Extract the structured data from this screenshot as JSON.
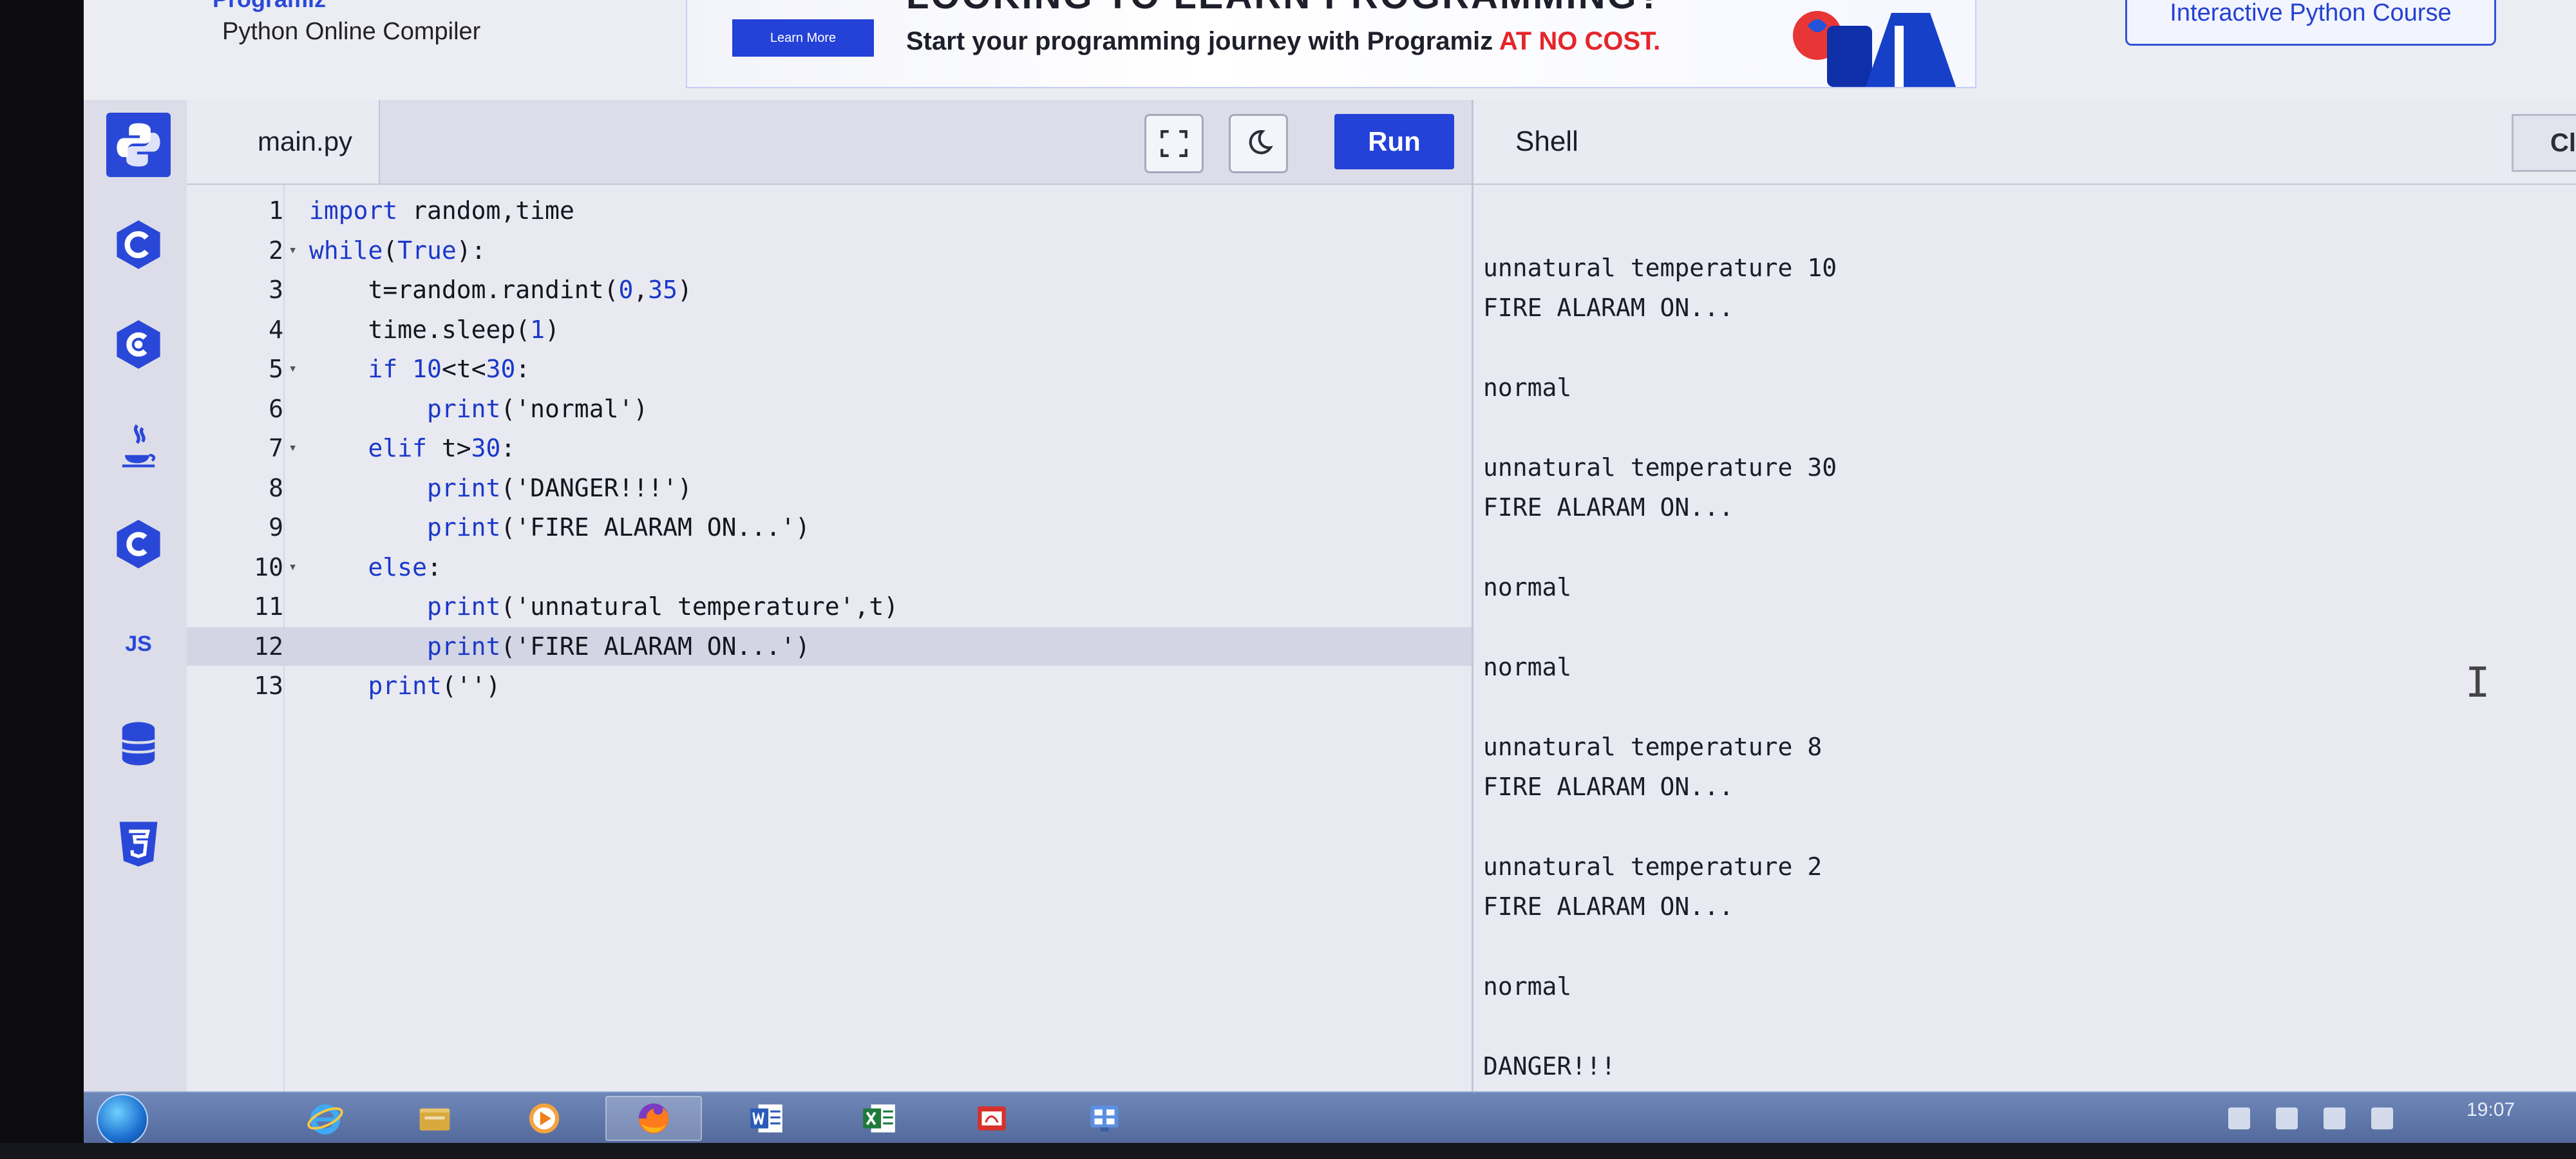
{
  "header": {
    "brand_top": "Programiz",
    "brand_subtitle": "Python Online Compiler",
    "ad": {
      "headline": "LOOKING TO LEARN PROGRAMMING?",
      "button_label": "Learn More",
      "text_main": "Start your programming journey with Programiz ",
      "text_emphasis": "AT NO COST."
    },
    "course_button": "Interactive Python Course"
  },
  "rail": {
    "items": [
      {
        "icon": "python-icon",
        "label": "Python",
        "active": true
      },
      {
        "icon": "c-icon",
        "label": "C"
      },
      {
        "icon": "cpp-icon",
        "label": "C++"
      },
      {
        "icon": "java-icon",
        "label": "Java"
      },
      {
        "icon": "csharp-icon",
        "label": "C#"
      },
      {
        "icon": "js-icon",
        "label": "JS"
      },
      {
        "icon": "database-icon",
        "label": "SQL"
      },
      {
        "icon": "html5-icon",
        "label": "HTML"
      }
    ],
    "js_text": "JS"
  },
  "editor": {
    "file_tab": "main.py",
    "run_label": "Run",
    "current_line": 12,
    "lines": [
      {
        "n": "1",
        "code": "import random,time"
      },
      {
        "n": "2",
        "code": "while(True):",
        "fold": true
      },
      {
        "n": "3",
        "code": "    t=random.randint(0,35)"
      },
      {
        "n": "4",
        "code": "    time.sleep(1)"
      },
      {
        "n": "5",
        "code": "    if 10<t<30:",
        "fold": true
      },
      {
        "n": "6",
        "code": "        print('normal')"
      },
      {
        "n": "7",
        "code": "    elif t>30:",
        "fold": true
      },
      {
        "n": "8",
        "code": "        print('DANGER!!!')"
      },
      {
        "n": "9",
        "code": "        print('FIRE ALARAM ON...')"
      },
      {
        "n": "10",
        "code": "    else:",
        "fold": true
      },
      {
        "n": "11",
        "code": "        print('unnatural temperature',t)"
      },
      {
        "n": "12",
        "code": "        print('FIRE ALARAM ON...')"
      },
      {
        "n": "13",
        "code": "    print('')"
      }
    ]
  },
  "shell": {
    "title": "Shell",
    "clear_label": "Clear",
    "output": [
      "",
      "unnatural temperature 10",
      "FIRE ALARAM ON...",
      "",
      "normal",
      "",
      "unnatural temperature 30",
      "FIRE ALARAM ON...",
      "",
      "normal",
      "",
      "normal",
      "",
      "unnatural temperature 8",
      "FIRE ALARAM ON...",
      "",
      "unnatural temperature 2",
      "FIRE ALARAM ON...",
      "",
      "normal",
      "",
      "DANGER!!!"
    ]
  },
  "taskbar": {
    "items": [
      "internet-explorer-icon",
      "file-explorer-icon",
      "media-player-icon",
      "firefox-icon",
      "word-icon",
      "excel-icon",
      "pdf-reader-icon",
      "control-panel-icon"
    ],
    "active": "firefox-icon",
    "clock": "19:07"
  }
}
